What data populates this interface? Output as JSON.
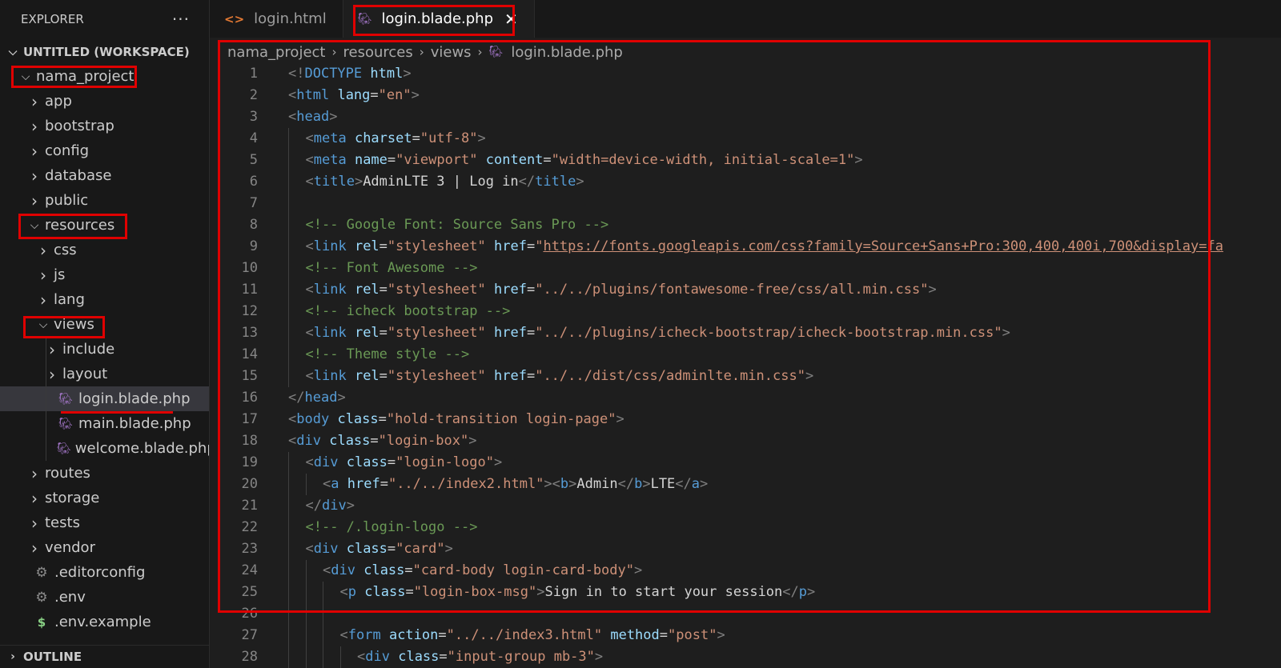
{
  "sidebar": {
    "title": "EXPLORER",
    "more": "···",
    "workspace": "UNTITLED (WORKSPACE)",
    "items": [
      {
        "label": "nama_project",
        "type": "folder",
        "open": true,
        "depth": 0
      },
      {
        "label": "app",
        "type": "folder",
        "open": false,
        "depth": 1
      },
      {
        "label": "bootstrap",
        "type": "folder",
        "open": false,
        "depth": 1
      },
      {
        "label": "config",
        "type": "folder",
        "open": false,
        "depth": 1
      },
      {
        "label": "database",
        "type": "folder",
        "open": false,
        "depth": 1
      },
      {
        "label": "public",
        "type": "folder",
        "open": false,
        "depth": 1
      },
      {
        "label": "resources",
        "type": "folder",
        "open": true,
        "depth": 1
      },
      {
        "label": "css",
        "type": "folder",
        "open": false,
        "depth": 2
      },
      {
        "label": "js",
        "type": "folder",
        "open": false,
        "depth": 2
      },
      {
        "label": "lang",
        "type": "folder",
        "open": false,
        "depth": 2
      },
      {
        "label": "views",
        "type": "folder",
        "open": true,
        "depth": 2
      },
      {
        "label": "include",
        "type": "folder",
        "open": false,
        "depth": 3
      },
      {
        "label": "layout",
        "type": "folder",
        "open": false,
        "depth": 3
      },
      {
        "label": "login.blade.php",
        "type": "php",
        "depth": 3,
        "selected": true
      },
      {
        "label": "main.blade.php",
        "type": "php",
        "depth": 3
      },
      {
        "label": "welcome.blade.php",
        "type": "php",
        "depth": 3
      },
      {
        "label": "routes",
        "type": "folder",
        "open": false,
        "depth": 1
      },
      {
        "label": "storage",
        "type": "folder",
        "open": false,
        "depth": 1
      },
      {
        "label": "tests",
        "type": "folder",
        "open": false,
        "depth": 1
      },
      {
        "label": "vendor",
        "type": "folder",
        "open": false,
        "depth": 1
      },
      {
        "label": ".editorconfig",
        "type": "gear",
        "depth": 1
      },
      {
        "label": ".env",
        "type": "gear",
        "depth": 1
      },
      {
        "label": ".env.example",
        "type": "dollar",
        "depth": 1
      }
    ],
    "outline": "OUTLINE"
  },
  "tabs": [
    {
      "label": "login.html",
      "icon": "html-icon",
      "active": false
    },
    {
      "label": "login.blade.php",
      "icon": "php-elephant-icon",
      "active": true
    }
  ],
  "breadcrumb": [
    "nama_project",
    "resources",
    "views",
    "login.blade.php"
  ],
  "editor": {
    "lines": [
      {
        "n": "1",
        "indent": 0,
        "t": [
          [
            "tg",
            "<!"
          ],
          [
            "tn",
            "DOCTYPE"
          ],
          [
            "tx",
            " "
          ],
          [
            "at",
            "html"
          ],
          [
            "tg",
            ">"
          ]
        ]
      },
      {
        "n": "2",
        "indent": 0,
        "t": [
          [
            "tg",
            "<"
          ],
          [
            "tn",
            "html"
          ],
          [
            "tx",
            " "
          ],
          [
            "at",
            "lang"
          ],
          [
            "tx",
            "="
          ],
          [
            "st",
            "\"en\""
          ],
          [
            "tg",
            ">"
          ]
        ]
      },
      {
        "n": "3",
        "indent": 0,
        "t": [
          [
            "tg",
            "<"
          ],
          [
            "tn",
            "head"
          ],
          [
            "tg",
            ">"
          ]
        ]
      },
      {
        "n": "4",
        "indent": 1,
        "t": [
          [
            "tg",
            "<"
          ],
          [
            "tn",
            "meta"
          ],
          [
            "tx",
            " "
          ],
          [
            "at",
            "charset"
          ],
          [
            "tx",
            "="
          ],
          [
            "st",
            "\"utf-8\""
          ],
          [
            "tg",
            ">"
          ]
        ]
      },
      {
        "n": "5",
        "indent": 1,
        "t": [
          [
            "tg",
            "<"
          ],
          [
            "tn",
            "meta"
          ],
          [
            "tx",
            " "
          ],
          [
            "at",
            "name"
          ],
          [
            "tx",
            "="
          ],
          [
            "st",
            "\"viewport\""
          ],
          [
            "tx",
            " "
          ],
          [
            "at",
            "content"
          ],
          [
            "tx",
            "="
          ],
          [
            "st",
            "\"width=device-width, initial-scale=1\""
          ],
          [
            "tg",
            ">"
          ]
        ]
      },
      {
        "n": "6",
        "indent": 1,
        "t": [
          [
            "tg",
            "<"
          ],
          [
            "tn",
            "title"
          ],
          [
            "tg",
            ">"
          ],
          [
            "tx",
            "AdminLTE 3 | Log in"
          ],
          [
            "tg",
            "</"
          ],
          [
            "tn",
            "title"
          ],
          [
            "tg",
            ">"
          ]
        ]
      },
      {
        "n": "7",
        "indent": 1,
        "t": []
      },
      {
        "n": "8",
        "indent": 1,
        "t": [
          [
            "cm",
            "<!-- Google Font: Source Sans Pro -->"
          ]
        ]
      },
      {
        "n": "9",
        "indent": 1,
        "t": [
          [
            "tg",
            "<"
          ],
          [
            "tn",
            "link"
          ],
          [
            "tx",
            " "
          ],
          [
            "at",
            "rel"
          ],
          [
            "tx",
            "="
          ],
          [
            "st",
            "\"stylesheet\""
          ],
          [
            "tx",
            " "
          ],
          [
            "at",
            "href"
          ],
          [
            "tx",
            "="
          ],
          [
            "st",
            "\""
          ],
          [
            "lk",
            "https://fonts.googleapis.com/css?family=Source+Sans+Pro:300,400,400i,700&display=fa"
          ]
        ]
      },
      {
        "n": "10",
        "indent": 1,
        "t": [
          [
            "cm",
            "<!-- Font Awesome -->"
          ]
        ]
      },
      {
        "n": "11",
        "indent": 1,
        "t": [
          [
            "tg",
            "<"
          ],
          [
            "tn",
            "link"
          ],
          [
            "tx",
            " "
          ],
          [
            "at",
            "rel"
          ],
          [
            "tx",
            "="
          ],
          [
            "st",
            "\"stylesheet\""
          ],
          [
            "tx",
            " "
          ],
          [
            "at",
            "href"
          ],
          [
            "tx",
            "="
          ],
          [
            "st",
            "\"../../plugins/fontawesome-free/css/all.min.css\""
          ],
          [
            "tg",
            ">"
          ]
        ]
      },
      {
        "n": "12",
        "indent": 1,
        "t": [
          [
            "cm",
            "<!-- icheck bootstrap -->"
          ]
        ]
      },
      {
        "n": "13",
        "indent": 1,
        "t": [
          [
            "tg",
            "<"
          ],
          [
            "tn",
            "link"
          ],
          [
            "tx",
            " "
          ],
          [
            "at",
            "rel"
          ],
          [
            "tx",
            "="
          ],
          [
            "st",
            "\"stylesheet\""
          ],
          [
            "tx",
            " "
          ],
          [
            "at",
            "href"
          ],
          [
            "tx",
            "="
          ],
          [
            "st",
            "\"../../plugins/icheck-bootstrap/icheck-bootstrap.min.css\""
          ],
          [
            "tg",
            ">"
          ]
        ]
      },
      {
        "n": "14",
        "indent": 1,
        "t": [
          [
            "cm",
            "<!-- Theme style -->"
          ]
        ]
      },
      {
        "n": "15",
        "indent": 1,
        "t": [
          [
            "tg",
            "<"
          ],
          [
            "tn",
            "link"
          ],
          [
            "tx",
            " "
          ],
          [
            "at",
            "rel"
          ],
          [
            "tx",
            "="
          ],
          [
            "st",
            "\"stylesheet\""
          ],
          [
            "tx",
            " "
          ],
          [
            "at",
            "href"
          ],
          [
            "tx",
            "="
          ],
          [
            "st",
            "\"../../dist/css/adminlte.min.css\""
          ],
          [
            "tg",
            ">"
          ]
        ]
      },
      {
        "n": "16",
        "indent": 0,
        "t": [
          [
            "tg",
            "</"
          ],
          [
            "tn",
            "head"
          ],
          [
            "tg",
            ">"
          ]
        ]
      },
      {
        "n": "17",
        "indent": 0,
        "t": [
          [
            "tg",
            "<"
          ],
          [
            "tn",
            "body"
          ],
          [
            "tx",
            " "
          ],
          [
            "at",
            "class"
          ],
          [
            "tx",
            "="
          ],
          [
            "st",
            "\"hold-transition login-page\""
          ],
          [
            "tg",
            ">"
          ]
        ]
      },
      {
        "n": "18",
        "indent": 0,
        "t": [
          [
            "tg",
            "<"
          ],
          [
            "tn",
            "div"
          ],
          [
            "tx",
            " "
          ],
          [
            "at",
            "class"
          ],
          [
            "tx",
            "="
          ],
          [
            "st",
            "\"login-box\""
          ],
          [
            "tg",
            ">"
          ]
        ]
      },
      {
        "n": "19",
        "indent": 1,
        "t": [
          [
            "tg",
            "<"
          ],
          [
            "tn",
            "div"
          ],
          [
            "tx",
            " "
          ],
          [
            "at",
            "class"
          ],
          [
            "tx",
            "="
          ],
          [
            "st",
            "\"login-logo\""
          ],
          [
            "tg",
            ">"
          ]
        ]
      },
      {
        "n": "20",
        "indent": 2,
        "t": [
          [
            "tg",
            "<"
          ],
          [
            "tn",
            "a"
          ],
          [
            "tx",
            " "
          ],
          [
            "at",
            "href"
          ],
          [
            "tx",
            "="
          ],
          [
            "st",
            "\"../../index2.html\""
          ],
          [
            "tg",
            "><"
          ],
          [
            "tn",
            "b"
          ],
          [
            "tg",
            ">"
          ],
          [
            "tx",
            "Admin"
          ],
          [
            "tg",
            "</"
          ],
          [
            "tn",
            "b"
          ],
          [
            "tg",
            ">"
          ],
          [
            "tx",
            "LTE"
          ],
          [
            "tg",
            "</"
          ],
          [
            "tn",
            "a"
          ],
          [
            "tg",
            ">"
          ]
        ]
      },
      {
        "n": "21",
        "indent": 1,
        "t": [
          [
            "tg",
            "</"
          ],
          [
            "tn",
            "div"
          ],
          [
            "tg",
            ">"
          ]
        ]
      },
      {
        "n": "22",
        "indent": 1,
        "t": [
          [
            "cm",
            "<!-- /.login-logo -->"
          ]
        ]
      },
      {
        "n": "23",
        "indent": 1,
        "t": [
          [
            "tg",
            "<"
          ],
          [
            "tn",
            "div"
          ],
          [
            "tx",
            " "
          ],
          [
            "at",
            "class"
          ],
          [
            "tx",
            "="
          ],
          [
            "st",
            "\"card\""
          ],
          [
            "tg",
            ">"
          ]
        ]
      },
      {
        "n": "24",
        "indent": 2,
        "t": [
          [
            "tg",
            "<"
          ],
          [
            "tn",
            "div"
          ],
          [
            "tx",
            " "
          ],
          [
            "at",
            "class"
          ],
          [
            "tx",
            "="
          ],
          [
            "st",
            "\"card-body login-card-body\""
          ],
          [
            "tg",
            ">"
          ]
        ]
      },
      {
        "n": "25",
        "indent": 3,
        "t": [
          [
            "tg",
            "<"
          ],
          [
            "tn",
            "p"
          ],
          [
            "tx",
            " "
          ],
          [
            "at",
            "class"
          ],
          [
            "tx",
            "="
          ],
          [
            "st",
            "\"login-box-msg\""
          ],
          [
            "tg",
            ">"
          ],
          [
            "tx",
            "Sign in to start your session"
          ],
          [
            "tg",
            "</"
          ],
          [
            "tn",
            "p"
          ],
          [
            "tg",
            ">"
          ]
        ]
      },
      {
        "n": "26",
        "indent": 3,
        "t": []
      },
      {
        "n": "27",
        "indent": 3,
        "t": [
          [
            "tg",
            "<"
          ],
          [
            "tn",
            "form"
          ],
          [
            "tx",
            " "
          ],
          [
            "at",
            "action"
          ],
          [
            "tx",
            "="
          ],
          [
            "st",
            "\"../../index3.html\""
          ],
          [
            "tx",
            " "
          ],
          [
            "at",
            "method"
          ],
          [
            "tx",
            "="
          ],
          [
            "st",
            "\"post\""
          ],
          [
            "tg",
            ">"
          ]
        ]
      },
      {
        "n": "28",
        "indent": 4,
        "t": [
          [
            "tg",
            "<"
          ],
          [
            "tn",
            "div"
          ],
          [
            "tx",
            " "
          ],
          [
            "at",
            "class"
          ],
          [
            "tx",
            "="
          ],
          [
            "st",
            "\"input-group mb-3\""
          ],
          [
            "tg",
            ">"
          ]
        ]
      }
    ]
  },
  "colors": {
    "annotation": "#e00000",
    "php_icon": "#a074c4",
    "html_icon": "#e37933"
  }
}
